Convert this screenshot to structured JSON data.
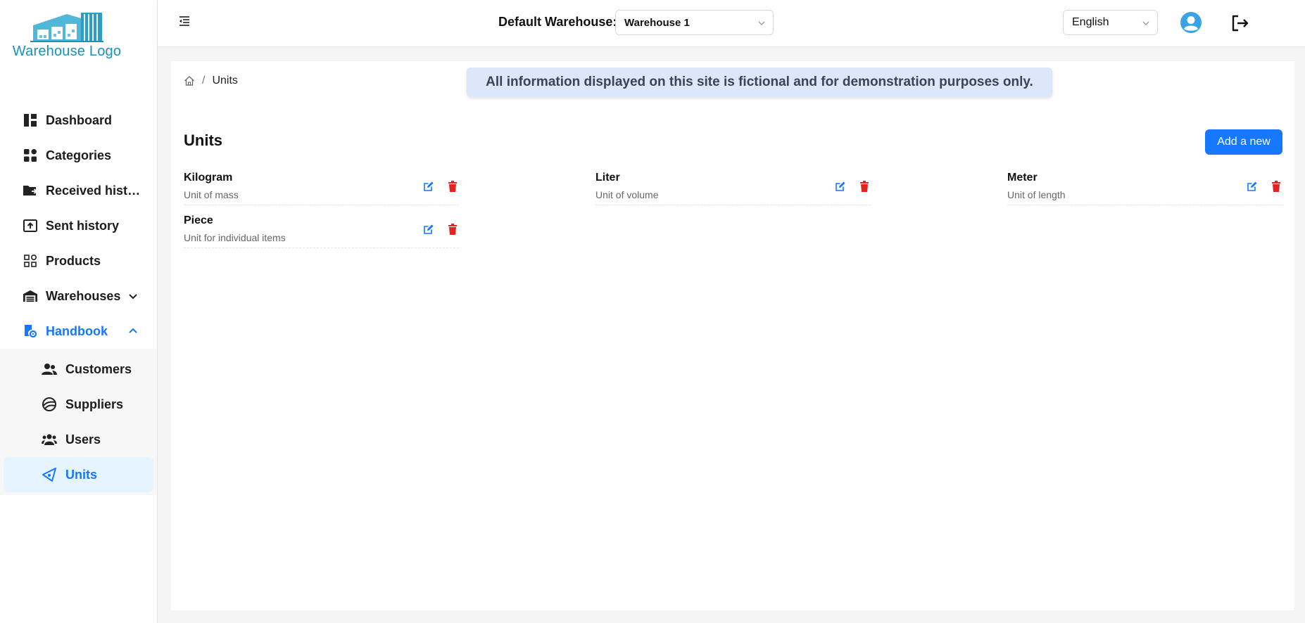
{
  "logo": {
    "text": "Warehouse Logo"
  },
  "sidebar": {
    "items": [
      {
        "label": "Dashboard",
        "icon": "dashboard-icon"
      },
      {
        "label": "Categories",
        "icon": "categories-icon"
      },
      {
        "label": "Received history",
        "icon": "received-folder-icon"
      },
      {
        "label": "Sent history",
        "icon": "sent-upload-icon"
      },
      {
        "label": "Products",
        "icon": "products-icon"
      },
      {
        "label": "Warehouses",
        "icon": "warehouse-icon"
      },
      {
        "label": "Handbook",
        "icon": "handbook-icon"
      }
    ],
    "handbook_sub": [
      {
        "label": "Customers",
        "icon": "customers-icon"
      },
      {
        "label": "Suppliers",
        "icon": "suppliers-icon"
      },
      {
        "label": "Users",
        "icon": "users-icon"
      },
      {
        "label": "Units",
        "icon": "units-icon"
      }
    ]
  },
  "header": {
    "warehouse_label": "Default Warehouse:",
    "warehouse_value": "Warehouse 1",
    "language_value": "English"
  },
  "breadcrumb": {
    "current": "Units"
  },
  "banner": {
    "text": "All information displayed on this site is fictional and for demonstration purposes only."
  },
  "main": {
    "title": "Units",
    "add_label": "Add a new",
    "units": [
      {
        "name": "Kilogram",
        "desc": "Unit of mass"
      },
      {
        "name": "Liter",
        "desc": "Unit of volume"
      },
      {
        "name": "Meter",
        "desc": "Unit of length"
      },
      {
        "name": "Piece",
        "desc": "Unit for individual items"
      }
    ]
  },
  "colors": {
    "accent": "#1677ff",
    "delete": "#e02424",
    "banner_bg": "#dce7fb",
    "logo": "#1a91b8"
  }
}
